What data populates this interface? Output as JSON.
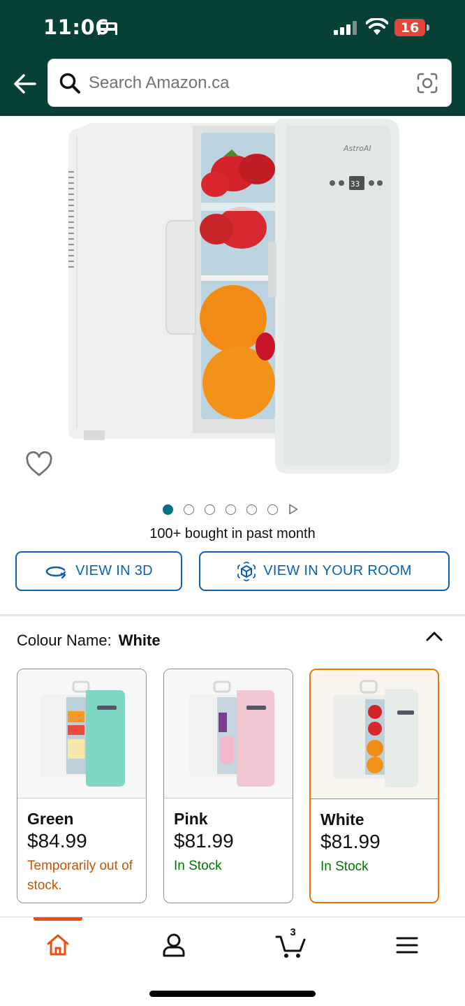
{
  "status_bar": {
    "time": "11:06",
    "battery": "16"
  },
  "search": {
    "placeholder": "Search Amazon.ca"
  },
  "product": {
    "brand_on_image": "AstroAI",
    "image_count": 6,
    "active_image_index": 0,
    "bought_text": "100+ bought in past month",
    "view_3d_label": "VIEW IN 3D",
    "view_room_label": "VIEW IN YOUR ROOM"
  },
  "colour": {
    "label": "Colour Name:",
    "selected": "White",
    "options": [
      {
        "name": "Green",
        "price": "$84.99",
        "status": "Temporarily out of stock.",
        "availability": "out",
        "door_color": "#7fd6c4"
      },
      {
        "name": "Pink",
        "price": "$81.99",
        "status": "In Stock",
        "availability": "in",
        "door_color": "#f1c7d3"
      },
      {
        "name": "White",
        "price": "$81.99",
        "status": "In Stock",
        "availability": "in",
        "door_color": "#e8ece8"
      }
    ]
  },
  "bottom_nav": {
    "cart_count": "3",
    "items": [
      "home-icon",
      "account-icon",
      "cart-icon",
      "menu-icon"
    ],
    "active": "home"
  },
  "colors": {
    "header_bg": "#064036",
    "accent_blue": "#0b5fb5",
    "teal": "#007185",
    "selected_orange": "#e77600",
    "out_of_stock": "#c45500",
    "in_stock": "#007600",
    "nav_active": "#ee4d0f"
  }
}
